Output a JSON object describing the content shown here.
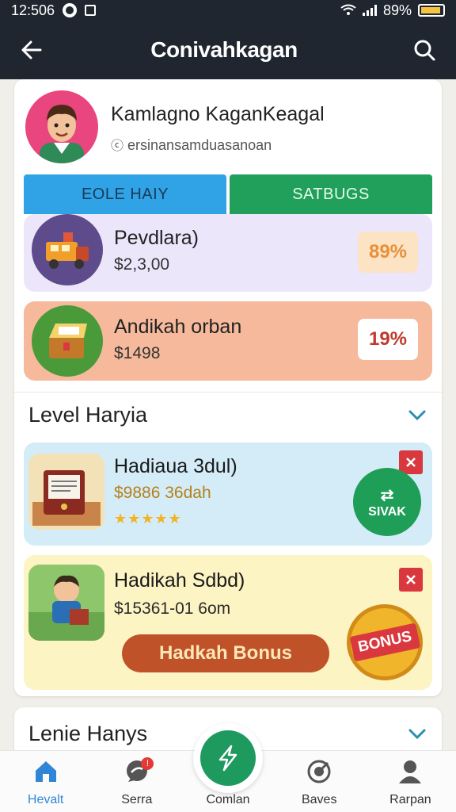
{
  "status_bar": {
    "time": "12:506",
    "battery_text": "89%",
    "icons": [
      "record-icon",
      "e-icon",
      "wifi-icon",
      "signal-icon",
      "battery-icon"
    ]
  },
  "app_bar": {
    "title": "Conivahkagan",
    "back_icon": "arrow-left-icon",
    "search_icon": "search-icon"
  },
  "profile": {
    "name": "Kamlagno KaganKeagal",
    "subtitle": "ersinansamduasanoan"
  },
  "tabs": [
    {
      "label": "EOLE HAIY",
      "color": "#2fa3e6"
    },
    {
      "label": "SATBUGS",
      "color": "#20a05a"
    }
  ],
  "rows": [
    {
      "title": "Pevdlara)",
      "amount": "$2,3,00",
      "percent": "89%",
      "percent_color": "#e8903a",
      "background": "#ece6fb"
    },
    {
      "title": "Andikah orban",
      "amount": "$1498",
      "percent": "19%",
      "percent_color": "#c0392b",
      "background": "#f6b99c"
    }
  ],
  "section1": {
    "title": "Level Haryia",
    "items": [
      {
        "title": "Hadiaua 3dul)",
        "subtitle": "$9886 36dah",
        "stars": "★★★★★",
        "badge_text": "SIVAK",
        "background": "#d4ecf7"
      },
      {
        "title": "Hadikah Sdbd)",
        "subtitle": "$15361-01 6om",
        "button_label": "Hadkah Bonus",
        "badge_text": "BONUS",
        "background": "#fdf4c4"
      }
    ]
  },
  "section2": {
    "title": "Lenie Hanys"
  },
  "bottom_nav": {
    "items": [
      {
        "label": "Hevalt",
        "icon": "home-icon",
        "active": true
      },
      {
        "label": "Serra",
        "icon": "chat-icon",
        "active": false,
        "badge": "!"
      },
      {
        "label": "Comlan",
        "icon": "bolt-icon",
        "active": false
      },
      {
        "label": "Baves",
        "icon": "target-icon",
        "active": false
      },
      {
        "label": "Rarpan",
        "icon": "person-icon",
        "active": false
      }
    ]
  }
}
